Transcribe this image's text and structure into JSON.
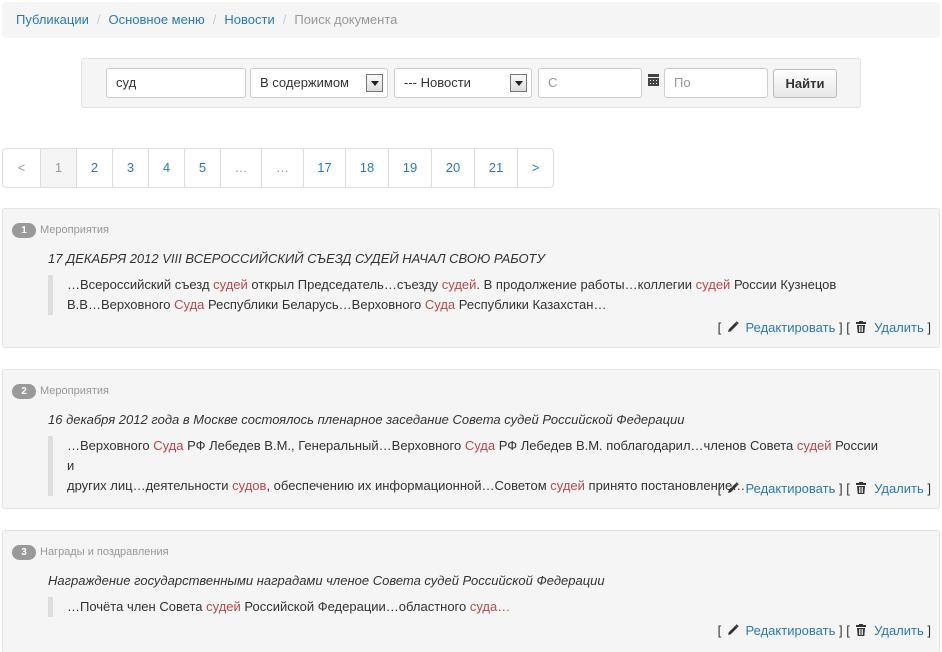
{
  "breadcrumb": {
    "items": [
      "Публикации",
      "Основное меню",
      "Новости"
    ],
    "separator": "/",
    "current": "Поиск документа"
  },
  "search": {
    "query": "суд",
    "scope": "В содержимом",
    "section": "--- Новости",
    "date_from_placeholder": "С",
    "date_to_placeholder": "По",
    "submit_label": "Найти"
  },
  "pagination": {
    "prev": "<",
    "pages": [
      "1",
      "2",
      "3",
      "4",
      "5",
      "…",
      "…",
      "17",
      "18",
      "19",
      "20",
      "21"
    ],
    "next": ">",
    "current": "1"
  },
  "results": [
    {
      "number": "1",
      "category": "Мероприятия",
      "title": "17 ДЕКАБРЯ 2012 VIII ВСЕРОССИЙСКИЙ СЪЕЗД СУДЕЙ НАЧАЛ СВОЮ РАБОТУ",
      "snippet_lines": [
        [
          [
            "…Всероссийский съезд ",
            false
          ],
          [
            "судей",
            true
          ],
          [
            " открыл Председатель…съезду ",
            false
          ],
          [
            "судей",
            true
          ],
          [
            ". В продолжение работы…коллегии ",
            false
          ],
          [
            "судей",
            true
          ],
          [
            " России Кузнецов",
            false
          ]
        ],
        [
          [
            "В.В…Верховного ",
            false
          ],
          [
            "Суда",
            true
          ],
          [
            " Республики Беларусь…Верховного ",
            false
          ],
          [
            "Суда",
            true
          ],
          [
            " Республики Казахстан…",
            false
          ]
        ]
      ]
    },
    {
      "number": "2",
      "category": "Мероприятия",
      "title": "16 декабря 2012 года в Москве состоялось пленарное заседание Совета судей Российской Федерации",
      "snippet_lines": [
        [
          [
            "…Верховного ",
            false
          ],
          [
            "Суда",
            true
          ],
          [
            " РФ Лебедев В.М., Генеральный…Верховного ",
            false
          ],
          [
            "Суда",
            true
          ],
          [
            " РФ Лебедев В.М. поблагодарил…членов Совета ",
            false
          ],
          [
            "судей",
            true
          ],
          [
            " России и",
            false
          ]
        ],
        [
          [
            "других лиц…деятельности ",
            false
          ],
          [
            "судов",
            true
          ],
          [
            ", обеспечению их информационной…Советом ",
            false
          ],
          [
            "судей",
            true
          ],
          [
            " принято постановление…",
            false
          ]
        ]
      ]
    },
    {
      "number": "3",
      "category": "Награды и поздравления",
      "title": "Награждение государственными наградами членое Совета судей Российской Федерации",
      "snippet_lines": [
        [
          [
            "…Почёта член Совета ",
            false
          ],
          [
            "судей",
            true
          ],
          [
            " Российской Федерации…областного ",
            false
          ],
          [
            "суда…",
            true
          ]
        ]
      ]
    }
  ],
  "actions": {
    "open_bracket": "[",
    "close_bracket": "]",
    "edit_label": "Редактировать",
    "delete_label": "Удалить"
  },
  "colors": {
    "link": "#2a7ab8",
    "highlight": "#b94a48",
    "well_bg": "#f5f5f5"
  }
}
